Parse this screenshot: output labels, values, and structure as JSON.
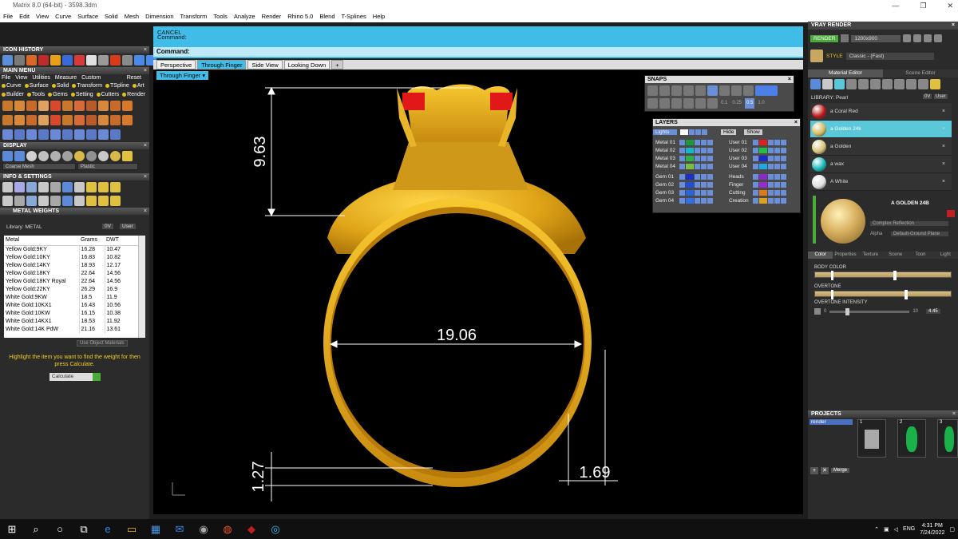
{
  "titlebar": {
    "title": "Matrix 8.0 (64-bit) - 3598.3dm",
    "minimize": "—",
    "restore": "❐",
    "close": "✕"
  },
  "menubar": [
    "File",
    "Edit",
    "View",
    "Curve",
    "Surface",
    "Solid",
    "Mesh",
    "Dimension",
    "Transform",
    "Tools",
    "Analyze",
    "Render",
    "Rhino 5.0",
    "Blend",
    "T-Splines",
    "Help"
  ],
  "left": {
    "icon_history": "ICON HISTORY",
    "main_menu": "MAIN MENU",
    "mm_items": [
      "File",
      "View",
      "Utilities",
      "Measure",
      "Custom"
    ],
    "mm_reset": "Reset",
    "categories_row1": [
      "Curve",
      "Surface",
      "Solid",
      "Transform",
      "TSpline",
      "Art"
    ],
    "categories_row2": [
      "Builder",
      "Tools",
      "Gems",
      "Setting",
      "Cutters",
      "Render"
    ],
    "display": "DISPLAY",
    "display_dd1": "Coarse Mesh",
    "display_dd2": "Plastic",
    "info_settings": "INFO & SETTINGS",
    "metal_weights": "METAL WEIGHTS",
    "library_label": "Library: METAL",
    "library_dd": "0V",
    "library_user": "User",
    "table_headers": [
      "Metal",
      "Grams",
      "DWT"
    ],
    "rows": [
      [
        "Yellow Gold:9KY",
        "16.28",
        "10.47"
      ],
      [
        "Yellow Gold:10KY",
        "16.83",
        "10.82"
      ],
      [
        "Yellow Gold:14KY",
        "18.93",
        "12.17"
      ],
      [
        "Yellow Gold:18KY",
        "22.64",
        "14.56"
      ],
      [
        "Yellow Gold:18KY Royal",
        "22.64",
        "14.56"
      ],
      [
        "Yellow Gold:22KY",
        "26.29",
        "16.9"
      ],
      [
        "White Gold:9KW",
        "18.5",
        "11.9"
      ],
      [
        "White Gold:10KX1",
        "16.43",
        "10.56"
      ],
      [
        "White Gold:10KW",
        "16.15",
        "10.38"
      ],
      [
        "White Gold:14KX1",
        "18.53",
        "11.92"
      ],
      [
        "White Gold:14K PdW",
        "21.16",
        "13.61"
      ]
    ],
    "use_object_materials": "Use Object Materials",
    "instructions": "Highlight the item you want to find the weight for then press Calculate.",
    "calculate": "Calculate"
  },
  "command": {
    "cancel": "CANCEL",
    "line2": "Command:",
    "prompt": "Command:"
  },
  "view_tabs": [
    "Perspective",
    "Through Finger",
    "Side View",
    "Looking Down",
    "+"
  ],
  "active_tab": 1,
  "viewport": {
    "dropdown": "Through Finger",
    "dims": {
      "height": "9.63",
      "width": "19.06",
      "shank": "1.27",
      "thickness": "1.69"
    }
  },
  "snaps": {
    "title": "SNAPS",
    "values": [
      "0.1",
      "0.25",
      "0.5",
      "1.0"
    ]
  },
  "layers": {
    "title": "LAYERS",
    "lights": "Lights",
    "hide": "Hide",
    "show": "Show",
    "left": [
      {
        "name": "Metal 01",
        "color": "#1a9a3a"
      },
      {
        "name": "Metal 02",
        "color": "#16b8c8"
      },
      {
        "name": "Metal 03",
        "color": "#2fb04a"
      },
      {
        "name": "Metal 04",
        "color": "#7ac043"
      },
      {
        "name": "Gem 01",
        "color": "#1a30c8"
      },
      {
        "name": "Gem 02",
        "color": "#2050d8"
      },
      {
        "name": "Gem 03",
        "color": "#2a64e0"
      },
      {
        "name": "Gem 04",
        "color": "#3070e8"
      }
    ],
    "right": [
      {
        "name": "User 01",
        "color": "#e02020"
      },
      {
        "name": "User 02",
        "color": "#22c040"
      },
      {
        "name": "User 03",
        "color": "#1a2ad0"
      },
      {
        "name": "User 04",
        "color": "#20a8e0"
      },
      {
        "name": "Heads",
        "color": "#8a2ac8"
      },
      {
        "name": "Finger",
        "color": "#9a2ad0"
      },
      {
        "name": "Cutting",
        "color": "#e07a18"
      },
      {
        "name": "Creation",
        "color": "#e0a020"
      }
    ]
  },
  "right": {
    "vray_render": "VRAY RENDER",
    "render_btn": "RENDER",
    "resolution": "1200x900",
    "style_label": "STYLE",
    "style_value": "Classic - (Fast)",
    "tabs": [
      "Material Editor",
      "Scene Editor"
    ],
    "library": "LIBRARY: Pearl",
    "library_dd": "0V",
    "library_user": "User",
    "materials": [
      {
        "name": "a Coral Red",
        "color": "#c01818"
      },
      {
        "name": "a Golden 24k",
        "color": "#d4b860"
      },
      {
        "name": "a Golden",
        "color": "#d8c478"
      },
      {
        "name": "a wax",
        "color": "#18b8b8"
      },
      {
        "name": "A White",
        "color": "#e0e0e0"
      }
    ],
    "selected": 1,
    "preview_name": "A GOLDEN 24B",
    "reflection_dd": "Complex Reflection",
    "alpha_label": "Alpha",
    "ground_dd": "Default-Ground Plane",
    "sub_tabs": [
      "Color",
      "Properties",
      "Texture",
      "Scene",
      "Toon",
      "Light"
    ],
    "body_color": "BODY COLOR",
    "overtone": "OVERTONE",
    "overtone_intensity": "OVERTONE INTENSITY",
    "intensity_min": "0",
    "intensity_max": "10",
    "intensity_value": "4.45",
    "projects": "PROJECTS",
    "project_item": "render",
    "thumbs": [
      "1",
      "2",
      "3"
    ],
    "merge": "Merge"
  },
  "taskbar": {
    "lang": "ENG",
    "time": "4:31 PM",
    "date": "7/24/2022"
  }
}
